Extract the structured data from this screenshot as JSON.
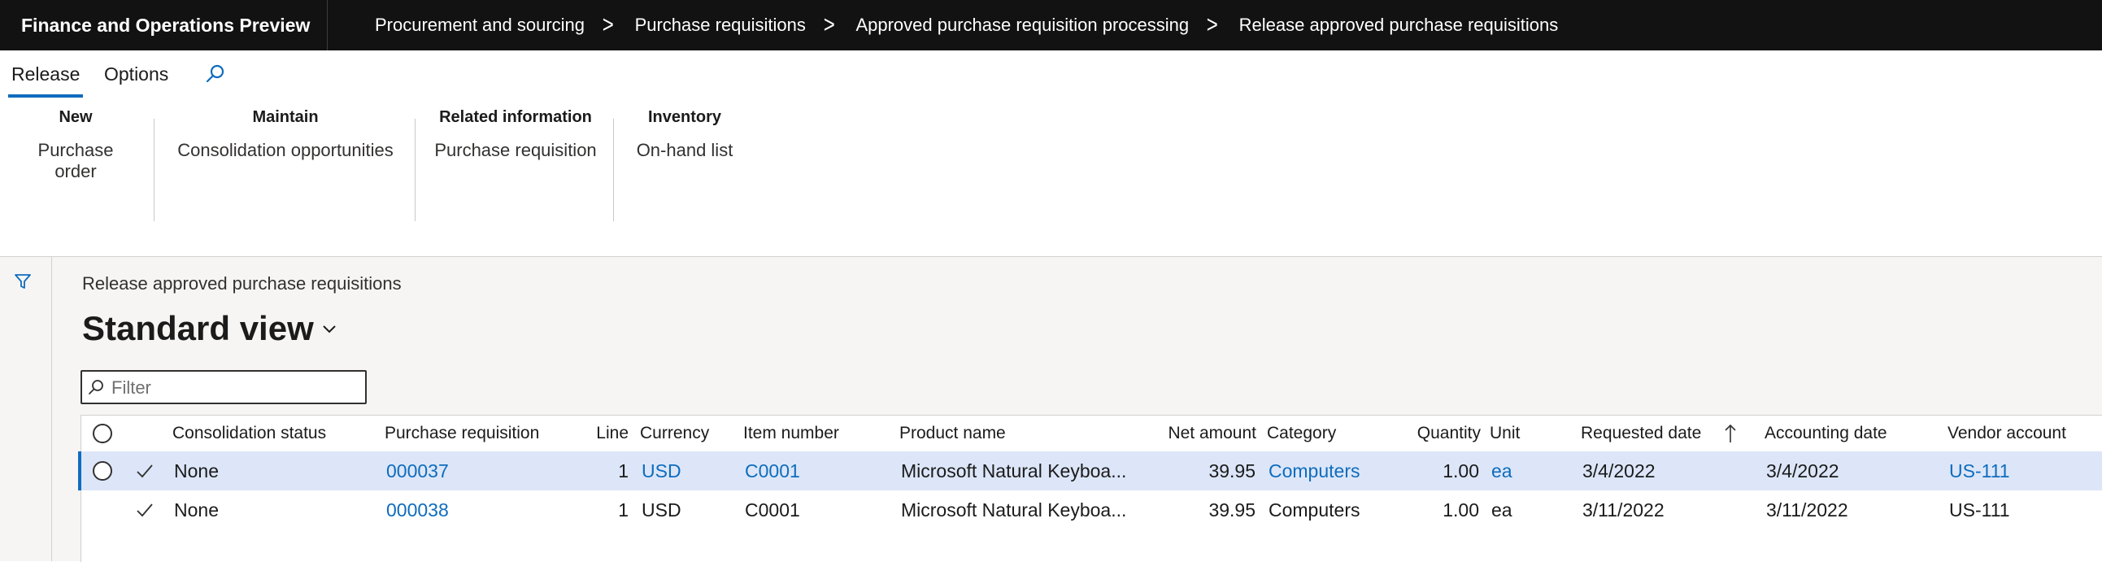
{
  "app": {
    "title": "Finance and Operations Preview"
  },
  "breadcrumbs": [
    "Procurement and sourcing",
    "Purchase requisitions",
    "Approved purchase requisition processing",
    "Release approved purchase requisitions"
  ],
  "tabs": {
    "release": "Release",
    "options": "Options"
  },
  "action_groups": [
    {
      "header": "New",
      "item": "Purchase order"
    },
    {
      "header": "Maintain",
      "item": "Consolidation opportunities"
    },
    {
      "header": "Related information",
      "item": "Purchase requisition"
    },
    {
      "header": "Inventory",
      "item": "On-hand list"
    }
  ],
  "page": {
    "subtitle": "Release approved purchase requisitions",
    "view_name": "Standard view",
    "filter_placeholder": "Filter"
  },
  "grid": {
    "columns": {
      "consolidation_status": "Consolidation status",
      "purchase_requisition": "Purchase requisition",
      "line": "Line",
      "currency": "Currency",
      "item_number": "Item number",
      "product_name": "Product name",
      "net_amount": "Net amount",
      "category": "Category",
      "quantity": "Quantity",
      "unit": "Unit",
      "requested_date": "Requested date",
      "accounting_date": "Accounting date",
      "vendor_account": "Vendor account"
    },
    "sort": {
      "column": "Requested date",
      "direction": "ascending"
    },
    "rows": [
      {
        "consolidation_status": "None",
        "purchase_requisition": "000037",
        "line": "1",
        "currency": "USD",
        "item_number": "C0001",
        "product_name": "Microsoft Natural Keyboa...",
        "net_amount": "39.95",
        "category": "Computers",
        "quantity": "1.00",
        "unit": "ea",
        "requested_date": "3/4/2022",
        "accounting_date": "3/4/2022",
        "vendor_account": "US-111",
        "selected": true
      },
      {
        "consolidation_status": "None",
        "purchase_requisition": "000038",
        "line": "1",
        "currency": "USD",
        "item_number": "C0001",
        "product_name": "Microsoft Natural Keyboa...",
        "net_amount": "39.95",
        "category": "Computers",
        "quantity": "1.00",
        "unit": "ea",
        "requested_date": "3/11/2022",
        "accounting_date": "3/11/2022",
        "vendor_account": "US-111",
        "selected": false
      }
    ]
  },
  "colors": {
    "accent": "#0f6cbd",
    "topbar": "#121212",
    "selected_row": "#dce6f8"
  }
}
